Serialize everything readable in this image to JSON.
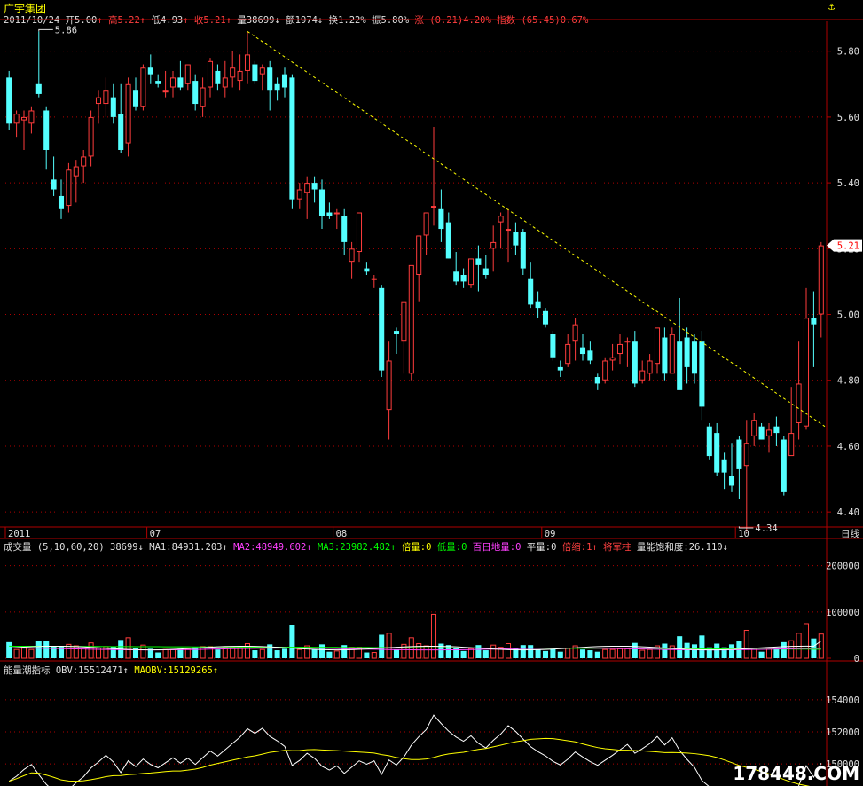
{
  "title": "广宇集团",
  "info": {
    "date": "2011/10/24",
    "open": "开5.00",
    "high": "高5.22",
    "low": "低4.93",
    "close": "收5.21",
    "vol": "量38699",
    "amount": "额1974",
    "turnover": "换1.22%",
    "amplitude": "振5.80%",
    "change": "涨 (0.21)4.20%",
    "index": "指数 (65.45)0.67%"
  },
  "chart_data": [
    {
      "type": "candlestick",
      "y_ticks": [
        "5.80",
        "5.60",
        "5.40",
        "5.20",
        "5.00",
        "4.80",
        "4.60",
        "4.40"
      ],
      "ylim": [
        4.36,
        5.88
      ],
      "x_labels": [
        {
          "label": "2011",
          "index": 0
        },
        {
          "label": "07",
          "index": 19
        },
        {
          "label": "08",
          "index": 44
        },
        {
          "label": "09",
          "index": 72
        },
        {
          "label": "10",
          "index": 98
        }
      ],
      "period_label": "日线",
      "high_marker": "5.86",
      "low_marker": "4.34",
      "last_price_tag": "5.21",
      "colors": {
        "up": "#ff3c3c",
        "down": "#54ffff",
        "trendline": "#ffff00"
      },
      "trendline": {
        "from": [
          32,
          5.86
        ],
        "to": [
          114,
          4.66
        ]
      },
      "ohlc": [
        [
          5.72,
          5.74,
          5.56,
          5.58
        ],
        [
          5.58,
          5.62,
          5.54,
          5.61
        ],
        [
          5.59,
          5.62,
          5.5,
          5.6
        ],
        [
          5.58,
          5.63,
          5.55,
          5.62
        ],
        [
          5.7,
          5.86,
          5.66,
          5.67
        ],
        [
          5.62,
          5.63,
          5.44,
          5.5
        ],
        [
          5.41,
          5.48,
          5.36,
          5.38
        ],
        [
          5.36,
          5.41,
          5.29,
          5.32
        ],
        [
          5.33,
          5.46,
          5.31,
          5.44
        ],
        [
          5.42,
          5.47,
          5.34,
          5.45
        ],
        [
          5.45,
          5.5,
          5.4,
          5.48
        ],
        [
          5.48,
          5.62,
          5.45,
          5.6
        ],
        [
          5.64,
          5.68,
          5.58,
          5.66
        ],
        [
          5.64,
          5.72,
          5.6,
          5.68
        ],
        [
          5.66,
          5.7,
          5.58,
          5.6
        ],
        [
          5.61,
          5.7,
          5.49,
          5.5
        ],
        [
          5.52,
          5.72,
          5.48,
          5.7
        ],
        [
          5.68,
          5.72,
          5.62,
          5.63
        ],
        [
          5.63,
          5.76,
          5.62,
          5.75
        ],
        [
          5.75,
          5.79,
          5.7,
          5.73
        ],
        [
          5.71,
          5.73,
          5.69,
          5.7
        ],
        [
          5.68,
          5.74,
          5.66,
          5.68
        ],
        [
          5.69,
          5.74,
          5.66,
          5.72
        ],
        [
          5.72,
          5.77,
          5.68,
          5.69
        ],
        [
          5.7,
          5.76,
          5.68,
          5.76
        ],
        [
          5.71,
          5.73,
          5.62,
          5.64
        ],
        [
          5.63,
          5.72,
          5.6,
          5.69
        ],
        [
          5.69,
          5.78,
          5.66,
          5.77
        ],
        [
          5.74,
          5.76,
          5.68,
          5.7
        ],
        [
          5.69,
          5.77,
          5.66,
          5.72
        ],
        [
          5.72,
          5.8,
          5.69,
          5.75
        ],
        [
          5.71,
          5.79,
          5.68,
          5.74
        ],
        [
          5.74,
          5.86,
          5.7,
          5.79
        ],
        [
          5.76,
          5.77,
          5.7,
          5.71
        ],
        [
          5.73,
          5.76,
          5.68,
          5.75
        ],
        [
          5.75,
          5.77,
          5.62,
          5.68
        ],
        [
          5.7,
          5.72,
          5.65,
          5.68
        ],
        [
          5.73,
          5.75,
          5.66,
          5.69
        ],
        [
          5.72,
          5.73,
          5.32,
          5.35
        ],
        [
          5.35,
          5.4,
          5.32,
          5.38
        ],
        [
          5.37,
          5.42,
          5.29,
          5.4
        ],
        [
          5.4,
          5.42,
          5.34,
          5.38
        ],
        [
          5.38,
          5.41,
          5.26,
          5.3
        ],
        [
          5.31,
          5.34,
          5.29,
          5.3
        ],
        [
          5.31,
          5.32,
          5.26,
          5.31
        ],
        [
          5.3,
          5.32,
          5.18,
          5.22
        ],
        [
          5.16,
          5.22,
          5.11,
          5.2
        ],
        [
          5.19,
          5.27,
          5.16,
          5.31
        ],
        [
          5.14,
          5.16,
          5.12,
          5.13
        ],
        [
          5.11,
          5.12,
          5.08,
          5.11
        ],
        [
          5.08,
          5.09,
          4.81,
          4.83
        ],
        [
          4.71,
          4.92,
          4.62,
          4.86
        ],
        [
          4.95,
          4.96,
          4.88,
          4.94
        ],
        [
          4.92,
          4.97,
          4.82,
          5.04
        ],
        [
          4.82,
          5.04,
          4.8,
          5.15
        ],
        [
          5.12,
          5.2,
          5.04,
          5.24
        ],
        [
          5.24,
          5.31,
          5.18,
          5.31
        ],
        [
          5.33,
          5.57,
          5.27,
          5.33
        ],
        [
          5.32,
          5.38,
          5.22,
          5.26
        ],
        [
          5.28,
          5.31,
          5.17,
          5.17
        ],
        [
          5.13,
          5.19,
          5.09,
          5.1
        ],
        [
          5.12,
          5.14,
          5.08,
          5.1
        ],
        [
          5.09,
          5.17,
          5.08,
          5.17
        ],
        [
          5.17,
          5.21,
          5.07,
          5.15
        ],
        [
          5.14,
          5.18,
          5.11,
          5.12
        ],
        [
          5.2,
          5.27,
          5.13,
          5.22
        ],
        [
          5.28,
          5.31,
          5.2,
          5.3
        ],
        [
          5.26,
          5.32,
          5.16,
          5.26
        ],
        [
          5.25,
          5.28,
          5.18,
          5.21
        ],
        [
          5.25,
          5.26,
          5.12,
          5.14
        ],
        [
          5.11,
          5.16,
          5.02,
          5.03
        ],
        [
          5.04,
          5.07,
          4.99,
          5.02
        ],
        [
          5.01,
          5.02,
          4.96,
          4.97
        ],
        [
          4.94,
          4.95,
          4.86,
          4.87
        ],
        [
          4.84,
          4.86,
          4.81,
          4.83
        ],
        [
          4.85,
          4.94,
          4.84,
          4.91
        ],
        [
          4.92,
          4.99,
          4.86,
          4.97
        ],
        [
          4.9,
          4.94,
          4.86,
          4.88
        ],
        [
          4.89,
          4.92,
          4.85,
          4.86
        ],
        [
          4.81,
          4.82,
          4.77,
          4.79
        ],
        [
          4.8,
          4.87,
          4.79,
          4.86
        ],
        [
          4.86,
          4.91,
          4.83,
          4.87
        ],
        [
          4.88,
          4.94,
          4.85,
          4.91
        ],
        [
          4.92,
          4.93,
          4.84,
          4.92
        ],
        [
          4.92,
          4.95,
          4.78,
          4.79
        ],
        [
          4.8,
          4.86,
          4.79,
          4.83
        ],
        [
          4.82,
          4.88,
          4.8,
          4.86
        ],
        [
          4.85,
          4.95,
          4.82,
          4.96
        ],
        [
          4.93,
          4.96,
          4.8,
          4.82
        ],
        [
          4.82,
          4.96,
          4.83,
          4.94
        ],
        [
          4.92,
          5.05,
          4.79,
          4.77
        ],
        [
          4.93,
          4.96,
          4.79,
          4.84
        ],
        [
          4.92,
          4.94,
          4.79,
          4.82
        ],
        [
          4.92,
          4.95,
          4.68,
          4.72
        ],
        [
          4.66,
          4.67,
          4.56,
          4.57
        ],
        [
          4.64,
          4.67,
          4.51,
          4.52
        ],
        [
          4.56,
          4.58,
          4.47,
          4.52
        ],
        [
          4.51,
          4.61,
          4.46,
          4.48
        ],
        [
          4.62,
          4.63,
          4.44,
          4.53
        ],
        [
          4.54,
          4.68,
          4.34,
          4.61
        ],
        [
          4.63,
          4.7,
          4.6,
          4.68
        ],
        [
          4.66,
          4.67,
          4.62,
          4.62
        ],
        [
          4.63,
          4.67,
          4.58,
          4.65
        ],
        [
          4.66,
          4.69,
          4.6,
          4.64
        ],
        [
          4.62,
          4.63,
          4.45,
          4.46
        ],
        [
          4.57,
          4.78,
          4.58,
          4.64
        ],
        [
          4.67,
          4.92,
          4.62,
          4.79
        ],
        [
          4.66,
          5.08,
          4.65,
          4.99
        ],
        [
          4.99,
          5.07,
          4.84,
          4.97
        ],
        [
          5.0,
          5.22,
          4.93,
          5.21
        ]
      ]
    },
    {
      "type": "bar",
      "name": "成交量",
      "y_ticks": [
        "200000",
        "100000",
        "0"
      ],
      "ylim": [
        0,
        200000
      ],
      "series_max_tick": 200000
    },
    {
      "type": "line",
      "name": "能量潮指标",
      "y_ticks": [
        "154000",
        "152000",
        "150000"
      ]
    }
  ],
  "volume_info": {
    "label": "成交量 (5,10,60,20)",
    "vol": "38699↓",
    "ma1": "MA1:84931.203↑",
    "ma2": "MA2:48949.602↑",
    "ma3": "MA3:23982.482↑",
    "beiliang": "倍量:0",
    "diliang": "低量:0",
    "bairi": "百日地量:0",
    "pingliang": "平量:0",
    "beisuo": "倍缩:1↑",
    "jiangjun": "将军柱",
    "baohe": "量能饱和度:26.110↓"
  },
  "obv_info": {
    "label": "能量潮指标",
    "obv": "OBV:15512471↑",
    "maobv": "MAOBV:15129265↑"
  },
  "watermark": "178448.COM",
  "anchor_icon": "anchor-icon"
}
